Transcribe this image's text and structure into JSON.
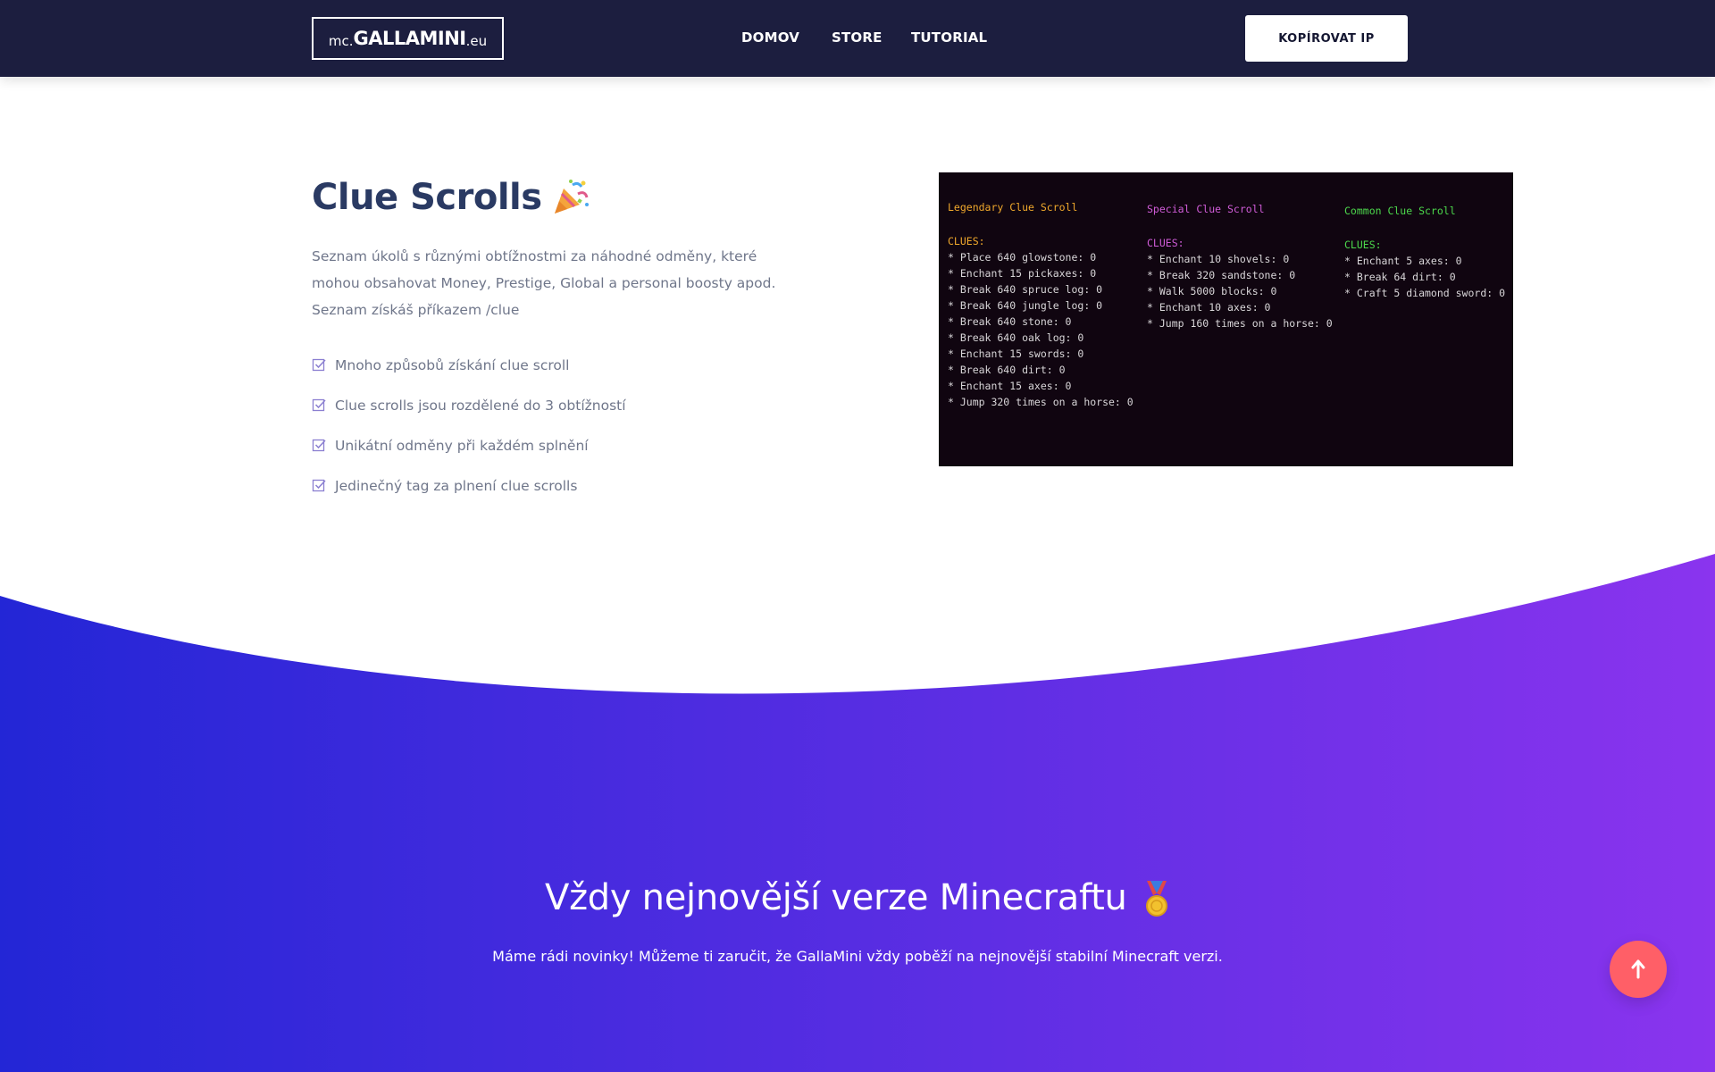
{
  "header": {
    "logo": {
      "prefix": "mc.",
      "name": "GALLAMINI",
      "suffix": ".eu"
    },
    "nav": [
      {
        "label": "DOMOV"
      },
      {
        "label": "STORE"
      },
      {
        "label": "TUTORIAL"
      }
    ],
    "copy_ip_label": "KOPÍROVAT IP"
  },
  "clue_section": {
    "title": "Clue Scrolls",
    "title_icon": "party-popper-icon",
    "description": "Seznam úkolů s různými obtížnostmi za náhodné odměny, které mohou obsahovat Money, Prestige, Global a personal boosty apod. Seznam získáš příkazem /clue",
    "features": [
      "Mnoho způsobů získání clue scroll",
      "Clue scrolls jsou rozdělené do 3 obtížností",
      "Unikátní odměny při každém splnění",
      "Jedinečný tag za plnení clue scrolls"
    ],
    "feature_icon": "check-square-icon"
  },
  "terminal": {
    "columns": [
      {
        "title": "Legendary Clue Scroll",
        "color": "#f0a82c",
        "clues_label": "CLUES:",
        "lines": [
          "* Place 640 glowstone: 0",
          "* Enchant 15 pickaxes: 0",
          "* Break 640 spruce log: 0",
          "* Break 640 jungle log: 0",
          "* Break 640 stone: 0",
          "* Break 640 oak log: 0",
          "* Enchant 15 swords: 0",
          "* Break 640 dirt: 0",
          "* Enchant 15 axes: 0",
          "* Jump 320 times on a horse: 0"
        ]
      },
      {
        "title": "Special Clue Scroll",
        "color": "#d05cd8",
        "clues_label": "CLUES:",
        "lines": [
          "* Enchant 10 shovels: 0",
          "* Break 320 sandstone: 0",
          "* Walk 5000 blocks: 0",
          "* Enchant 10 axes: 0",
          "* Jump 160 times on a horse: 0"
        ]
      },
      {
        "title": "Common Clue Scroll",
        "color": "#4cd84c",
        "clues_label": "CLUES:",
        "lines": [
          "* Enchant 5 axes: 0",
          "* Break 64 dirt: 0",
          "* Craft 5 diamond sword: 0"
        ]
      }
    ]
  },
  "minecraft_section": {
    "title": "Vždy nejnovější verze Minecraftu",
    "title_icon": "medal-icon",
    "subtitle": "Máme rádi novinky! Můžeme ti zaručit, že GallaMini vždy poběží na nejnovější stabilní Minecraft verzi.",
    "gradient_from": "#2326d6",
    "gradient_to": "#8a34ee"
  },
  "scroll_top": {
    "icon": "arrow-up-icon",
    "color": "#ff5f67"
  }
}
